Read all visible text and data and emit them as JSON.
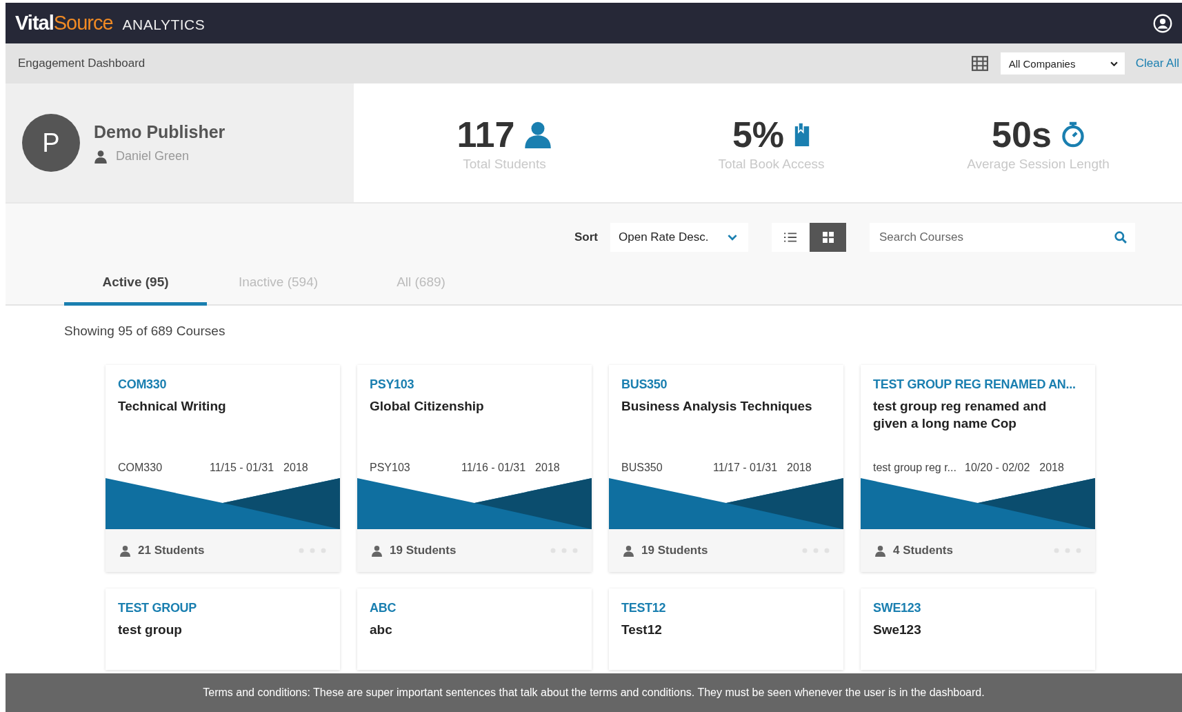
{
  "header": {
    "logo": {
      "first": "Vital",
      "second": "Source",
      "suffix": "ANALYTICS"
    }
  },
  "filter_bar": {
    "breadcrumb": "Engagement Dashboard",
    "company_select": "All Companies",
    "clear": "Clear All"
  },
  "profile": {
    "avatar_letter": "P",
    "name": "Demo Publisher",
    "user": "Daniel Green"
  },
  "stats": [
    {
      "value": "117",
      "label": "Total Students",
      "kind": "person"
    },
    {
      "value": "5%",
      "label": "Total Book Access",
      "kind": "book"
    },
    {
      "value": "50s",
      "label": "Average Session Length",
      "kind": "timer"
    }
  ],
  "toolbar": {
    "sort_label": "Sort",
    "sort_value": "Open Rate Desc.",
    "views": [
      {
        "kind": "list",
        "selected": false
      },
      {
        "kind": "grid",
        "selected": true
      }
    ],
    "search": {
      "placeholder": "Search Courses"
    }
  },
  "tabs": [
    {
      "label": "Active (95)",
      "selected": true
    },
    {
      "label": "Inactive (594)",
      "selected": false
    },
    {
      "label": "All (689)",
      "selected": false
    }
  ],
  "summary": "Showing 95 of 689 Courses",
  "courses": [
    {
      "code": "COM330",
      "title": "Technical Writing",
      "meta_code": "COM330",
      "dates": "11/15 - 01/31",
      "year": "2018",
      "students": "21 Students"
    },
    {
      "code": "PSY103",
      "title": "Global Citizenship",
      "meta_code": "PSY103",
      "dates": "11/16 - 01/31",
      "year": "2018",
      "students": "19 Students"
    },
    {
      "code": "BUS350",
      "title": "Business Analysis Techniques",
      "meta_code": "BUS350",
      "dates": "11/17 - 01/31",
      "year": "2018",
      "students": "19 Students"
    },
    {
      "code": "TEST GROUP REG RENAMED AN...",
      "title": "test group reg renamed and given a long name Cop",
      "meta_code": "test group reg r...",
      "dates": "10/20 - 02/02",
      "year": "2018",
      "students": "4 Students"
    },
    {
      "code": "TEST GROUP",
      "title": "test group"
    },
    {
      "code": "ABC",
      "title": "abc"
    },
    {
      "code": "TEST12",
      "title": "Test12"
    },
    {
      "code": "SWE123",
      "title": "Swe123"
    }
  ],
  "terms_banner": "Terms and conditions: These are super important sentences that talk about the terms and conditions. They must be seen whenever the user is in the dashboard."
}
